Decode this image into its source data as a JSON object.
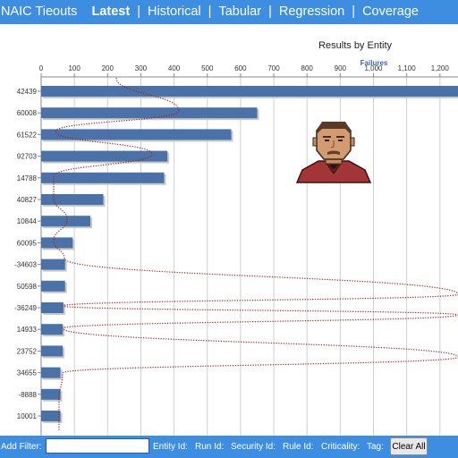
{
  "header": {
    "brand": "NAIC Tieouts",
    "nav": [
      {
        "label": "Latest",
        "active": true
      },
      {
        "label": "Historical",
        "active": false
      },
      {
        "label": "Tabular",
        "active": false
      },
      {
        "label": "Regression",
        "active": false
      },
      {
        "label": "Coverage",
        "active": false
      }
    ],
    "separator": "|"
  },
  "chart_data": {
    "type": "bar",
    "orientation": "horizontal",
    "title": "Results by Entity",
    "series": [
      {
        "name": "Failures",
        "color": "#4a72a8"
      }
    ],
    "categories": [
      "42439",
      "60008",
      "61522",
      "92703",
      "14788",
      "40827",
      "10844",
      "60095",
      "-34603",
      "50598",
      "-36249",
      "14933",
      "23752",
      "34655",
      "-8888",
      "10001"
    ],
    "values": [
      1300,
      650,
      572,
      380,
      370,
      187,
      148,
      95,
      72,
      72,
      67,
      65,
      65,
      58,
      58,
      58
    ],
    "xticks": [
      0,
      100,
      200,
      300,
      400,
      500,
      600,
      700,
      800,
      900,
      1000,
      1100,
      1200
    ],
    "xtick_labels": [
      "0",
      "100",
      "200",
      "300",
      "400",
      "500",
      "600",
      "700",
      "800",
      "900",
      "1,000",
      "1,100",
      "1,200"
    ],
    "xlabel": "Failures",
    "ylabel": "",
    "xlim": [
      0,
      1260
    ],
    "grid": true,
    "legend": "none",
    "trend_line_color": "#a02020",
    "trend_line_style": "dotted"
  },
  "avatar": {
    "icon": "user-portrait-icon"
  },
  "filters": {
    "add_filter_label": "Add Filter:",
    "input_value": "",
    "input_placeholder": "",
    "fields": [
      "Entity Id:",
      "Run Id:",
      "Security Id:",
      "Rule Id:",
      "Criticality:",
      "Tag:"
    ],
    "clear_label": "Clear All"
  }
}
